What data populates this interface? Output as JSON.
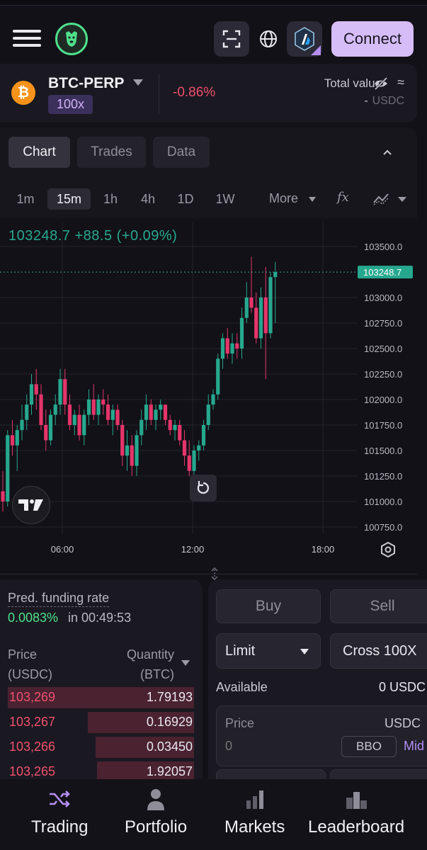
{
  "header": {
    "connect_label": "Connect"
  },
  "market": {
    "symbol": "BTC-PERP",
    "leverage": "100x",
    "change": "-0.86%",
    "total_value_label": "Total value",
    "total_value_approx": "≈",
    "total_value_amount": "-",
    "total_value_unit": "USDC"
  },
  "chart_panel": {
    "tabs": [
      "Chart",
      "Trades",
      "Data"
    ],
    "active_tab": "Chart",
    "timeframes": [
      "1m",
      "15m",
      "1h",
      "4h",
      "1D",
      "1W"
    ],
    "active_timeframe": "15m",
    "more_label": "More",
    "fx_label": "fx"
  },
  "chart_data": {
    "type": "candlestick",
    "symbol": "BTC-PERP",
    "interval": "15m",
    "ohlc_readout": "103248.7  +88.5 (+0.09%)",
    "last_price": 103248.7,
    "last_price_label": "103248.7",
    "y_ticks": [
      103500.0,
      103000.0,
      102750.0,
      102500.0,
      102250.0,
      102000.0,
      101750.0,
      101500.0,
      101250.0,
      101000.0,
      100750.0
    ],
    "y_tick_labels": [
      "103500.0",
      "103000.0",
      "102750.0",
      "102500.0",
      "102250.0",
      "102000.0",
      "101750.0",
      "101500.0",
      "101250.0",
      "101000.0",
      "100750.0"
    ],
    "x_tick_labels": [
      "06:00",
      "12:00",
      "18:00"
    ],
    "ylim": [
      100650,
      103550
    ],
    "colors": {
      "up": "#26a88e",
      "down": "#e5356b",
      "grid": "#24232b"
    },
    "candles": [
      [
        101100,
        101300,
        100900,
        101000
      ],
      [
        101000,
        101700,
        100950,
        101650
      ],
      [
        101650,
        101800,
        101450,
        101550
      ],
      [
        101550,
        101750,
        101300,
        101700
      ],
      [
        101700,
        101950,
        101600,
        101800
      ],
      [
        101800,
        102050,
        101700,
        101950
      ],
      [
        101950,
        102250,
        101850,
        102150
      ],
      [
        102150,
        102300,
        101900,
        102050
      ],
      [
        102050,
        102150,
        101700,
        101750
      ],
      [
        101750,
        101900,
        101500,
        101600
      ],
      [
        101600,
        101900,
        101550,
        101850
      ],
      [
        101850,
        102050,
        101750,
        101950
      ],
      [
        101950,
        102300,
        101850,
        102200
      ],
      [
        102200,
        102300,
        101850,
        101950
      ],
      [
        101950,
        102050,
        101700,
        101750
      ],
      [
        101750,
        101900,
        101650,
        101850
      ],
      [
        101850,
        101950,
        101600,
        101650
      ],
      [
        101650,
        101900,
        101550,
        101850
      ],
      [
        101850,
        102100,
        101750,
        102000
      ],
      [
        102000,
        102150,
        101800,
        101850
      ],
      [
        101850,
        102050,
        101750,
        102000
      ],
      [
        102000,
        102100,
        101850,
        101950
      ],
      [
        101950,
        102050,
        101750,
        101800
      ],
      [
        101800,
        101950,
        101650,
        101900
      ],
      [
        101900,
        101950,
        101700,
        101750
      ],
      [
        101750,
        101800,
        101350,
        101450
      ],
      [
        101450,
        101700,
        101300,
        101550
      ],
      [
        101550,
        101650,
        101250,
        101350
      ],
      [
        101350,
        101700,
        101250,
        101650
      ],
      [
        101650,
        101900,
        101550,
        101800
      ],
      [
        101800,
        102050,
        101700,
        101950
      ],
      [
        101950,
        102000,
        101750,
        101800
      ],
      [
        101800,
        101950,
        101700,
        101900
      ],
      [
        101900,
        102000,
        101800,
        101950
      ],
      [
        101950,
        101950,
        101750,
        101800
      ],
      [
        101800,
        101850,
        101650,
        101700
      ],
      [
        101700,
        101800,
        101600,
        101750
      ],
      [
        101750,
        101800,
        101550,
        101600
      ],
      [
        101600,
        101700,
        101350,
        101450
      ],
      [
        101450,
        101600,
        101250,
        101300
      ],
      [
        101300,
        101550,
        101250,
        101500
      ],
      [
        101500,
        101600,
        101400,
        101550
      ],
      [
        101550,
        101800,
        101500,
        101750
      ],
      [
        101750,
        102050,
        101700,
        101950
      ],
      [
        101950,
        102100,
        101900,
        102050
      ],
      [
        102050,
        102450,
        102000,
        102400
      ],
      [
        102400,
        102650,
        102300,
        102600
      ],
      [
        102600,
        102700,
        102400,
        102450
      ],
      [
        102450,
        102650,
        102350,
        102550
      ],
      [
        102550,
        102650,
        102400,
        102500
      ],
      [
        102500,
        102900,
        102400,
        102800
      ],
      [
        102800,
        103150,
        102750,
        103000
      ],
      [
        103000,
        103400,
        102850,
        102900
      ],
      [
        102900,
        103050,
        102550,
        102600
      ],
      [
        102600,
        103100,
        102500,
        103000
      ],
      [
        103000,
        103300,
        102200,
        102650
      ],
      [
        102650,
        103250,
        102600,
        103200
      ],
      [
        103200,
        103350,
        102750,
        103250
      ]
    ]
  },
  "orderbook": {
    "funding_label": "Pred. funding rate",
    "funding_rate": "0.0083%",
    "funding_in": "in 00:49:53",
    "price_header": "Price\n(USDC)",
    "price_header_1": "Price",
    "price_header_2": "(USDC)",
    "qty_header_1": "Quantity",
    "qty_header_2": "(BTC)",
    "asks": [
      {
        "price": "103,269",
        "qty": "1.79193",
        "depth": 1.0
      },
      {
        "price": "103,267",
        "qty": "0.16929",
        "depth": 0.57
      },
      {
        "price": "103,266",
        "qty": "0.03450",
        "depth": 0.53
      },
      {
        "price": "103,265",
        "qty": "1.92057",
        "depth": 0.52
      }
    ]
  },
  "order_form": {
    "buy_label": "Buy",
    "sell_label": "Sell",
    "order_type": "Limit",
    "margin_mode": "Cross 100X",
    "available_label": "Available",
    "available_value": "0 USDC",
    "price_label": "Price",
    "price_unit": "USDC",
    "price_placeholder": "0",
    "bbo_label": "BBO",
    "mid_label": "Mid"
  },
  "bottom_nav": {
    "items": [
      "Trading",
      "Portfolio",
      "Markets",
      "Leaderboard"
    ]
  }
}
